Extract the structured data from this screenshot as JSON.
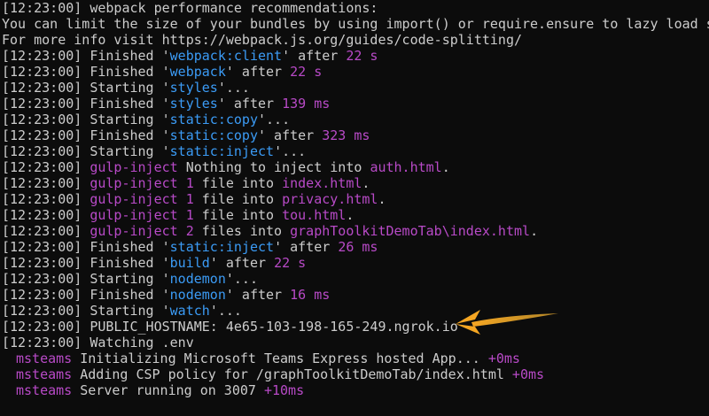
{
  "colors": {
    "background": "#0c0c0c",
    "default_text": "#cccccc",
    "blue": "#3b9bf5",
    "purple": "#b84ac7",
    "arrow": "#f5a623"
  },
  "header": {
    "line1": "[12:23:00] webpack performance recommendations:",
    "line2": "You can limit the size of your bundles by using import() or require.ensure to lazy load s",
    "line3": "For more info visit https://webpack.js.org/guides/code-splitting/"
  },
  "log": [
    {
      "ts": "[12:23:00]",
      "a": " Finished '",
      "b": "webpack:client",
      "c": "' after ",
      "d": "22 s",
      "e": ""
    },
    {
      "ts": "[12:23:00]",
      "a": " Finished '",
      "b": "webpack",
      "c": "' after ",
      "d": "22 s",
      "e": ""
    },
    {
      "ts": "[12:23:00]",
      "a": " Starting '",
      "b": "styles",
      "c": "'...",
      "d": "",
      "e": ""
    },
    {
      "ts": "[12:23:00]",
      "a": " Finished '",
      "b": "styles",
      "c": "' after ",
      "d": "139 ms",
      "e": ""
    },
    {
      "ts": "[12:23:00]",
      "a": " Starting '",
      "b": "static:copy",
      "c": "'...",
      "d": "",
      "e": ""
    },
    {
      "ts": "[12:23:00]",
      "a": " Finished '",
      "b": "static:copy",
      "c": "' after ",
      "d": "323 ms",
      "e": ""
    },
    {
      "ts": "[12:23:00]",
      "a": " Starting '",
      "b": "static:inject",
      "c": "'...",
      "d": "",
      "e": ""
    }
  ],
  "inject": [
    {
      "ts": "[12:23:00]",
      "tag": "gulp-inject",
      "n": "",
      "mid": " Nothing to inject into ",
      "file": "auth.html",
      "end": "."
    },
    {
      "ts": "[12:23:00]",
      "tag": "gulp-inject",
      "n": " 1",
      "mid": " file into ",
      "file": "index.html",
      "end": "."
    },
    {
      "ts": "[12:23:00]",
      "tag": "gulp-inject",
      "n": " 1",
      "mid": " file into ",
      "file": "privacy.html",
      "end": "."
    },
    {
      "ts": "[12:23:00]",
      "tag": "gulp-inject",
      "n": " 1",
      "mid": " file into ",
      "file": "tou.html",
      "end": "."
    },
    {
      "ts": "[12:23:00]",
      "tag": "gulp-inject",
      "n": " 2",
      "mid": " files into ",
      "file": "graphToolkitDemoTab\\index.html",
      "end": "."
    }
  ],
  "log2": [
    {
      "ts": "[12:23:00]",
      "a": " Finished '",
      "b": "static:inject",
      "c": "' after ",
      "d": "26 ms"
    },
    {
      "ts": "[12:23:00]",
      "a": " Finished '",
      "b": "build",
      "c": "' after ",
      "d": "22 s"
    },
    {
      "ts": "[12:23:00]",
      "a": " Starting '",
      "b": "nodemon",
      "c": "'...",
      "d": ""
    },
    {
      "ts": "[12:23:00]",
      "a": " Finished '",
      "b": "nodemon",
      "c": "' after ",
      "d": "16 ms"
    },
    {
      "ts": "[12:23:00]",
      "a": " Starting '",
      "b": "watch",
      "c": "'...",
      "d": ""
    }
  ],
  "hostname": {
    "ts": "[12:23:00]",
    "text": " PUBLIC_HOSTNAME: 4e65-103-198-165-249.ngrok.io"
  },
  "watching": {
    "ts": "[12:23:00]",
    "text": " Watching .env"
  },
  "msteams": [
    {
      "tag": "msteams",
      "text": " Initializing Microsoft Teams Express hosted App... ",
      "time": "+0ms"
    },
    {
      "tag": "msteams",
      "text": " Adding CSP policy for /graphToolkitDemoTab/index.html ",
      "time": "+0ms"
    },
    {
      "tag": "msteams",
      "text": " Server running on 3007 ",
      "time": "+10ms"
    }
  ],
  "annotation": {
    "icon": "orange-arrow-icon"
  }
}
